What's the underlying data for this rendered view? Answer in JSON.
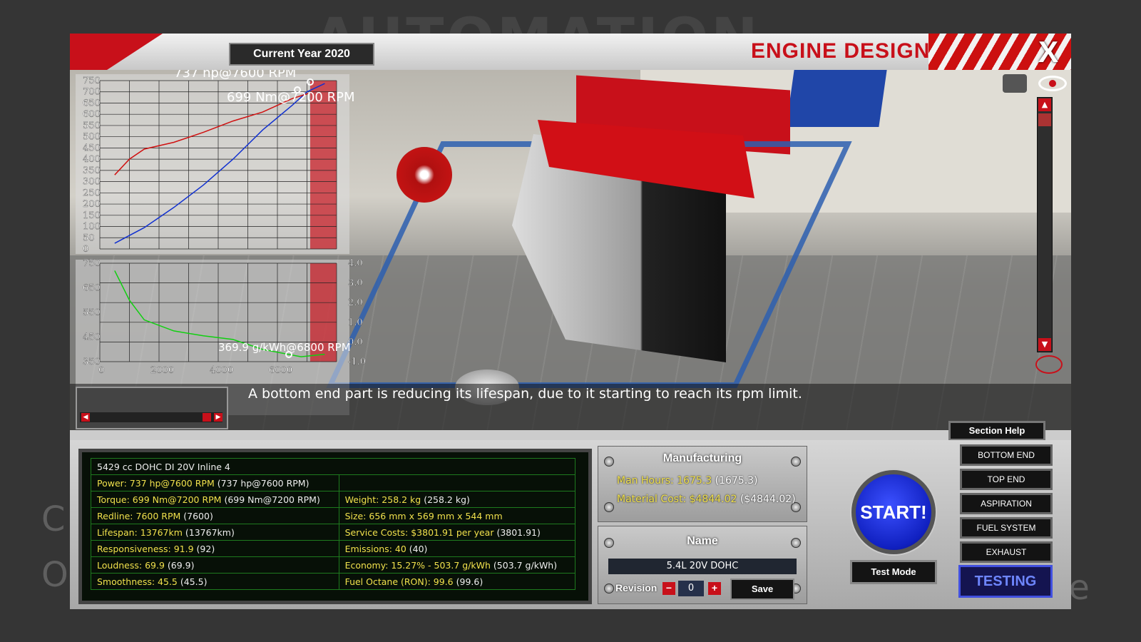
{
  "background": {
    "title": "AUTOMATION",
    "left_text_1": "C",
    "left_text_2": "O",
    "right_text": "he"
  },
  "header": {
    "current_year": "Current Year 2020",
    "title": "ENGINE DESIGN",
    "close": "X"
  },
  "graphs": {
    "power_label": "737 hp@7600 RPM",
    "torque_label": "699 Nm@7200 RPM",
    "bsfc_label": "369.9 g/kWh@6800 RPM",
    "top_y_ticks": [
      "750",
      "700",
      "650",
      "600",
      "550",
      "500",
      "450",
      "400",
      "350",
      "300",
      "250",
      "200",
      "150",
      "100",
      "50",
      "0"
    ],
    "bottom_y_ticks": [
      "750",
      "650",
      "550",
      "450",
      "350"
    ],
    "bottom_right_ticks": [
      "4.0",
      "3.0",
      "2.0",
      "1.0",
      "0.0",
      "-1.0"
    ],
    "x_ticks": [
      "0",
      "2000",
      "4000",
      "6000"
    ]
  },
  "chart_data": [
    {
      "type": "line",
      "x_unit": "RPM",
      "ylim": [
        0,
        750
      ],
      "series": [
        {
          "name": "Power",
          "color": "#1030d0",
          "x": [
            500,
            1500,
            2500,
            3500,
            4500,
            5500,
            6500,
            7000,
            7600
          ],
          "values": [
            25,
            95,
            185,
            285,
            400,
            530,
            640,
            700,
            737
          ]
        },
        {
          "name": "Torque",
          "color": "#d01010",
          "x": [
            500,
            1000,
            1500,
            2500,
            3500,
            4500,
            5500,
            6500,
            7200
          ],
          "values": [
            330,
            400,
            445,
            475,
            520,
            570,
            610,
            670,
            699
          ]
        }
      ]
    },
    {
      "type": "line",
      "x_unit": "RPM",
      "ylim": [
        350,
        750
      ],
      "series": [
        {
          "name": "BSFC",
          "color": "#10c010",
          "x": [
            500,
            1000,
            1500,
            2500,
            3500,
            4500,
            5500,
            6800,
            7600
          ],
          "values": [
            720,
            600,
            520,
            475,
            455,
            440,
            400,
            369.9,
            380
          ]
        }
      ]
    }
  ],
  "message": "A bottom end part is reducing its lifespan, due to it starting to reach its rpm limit.",
  "section_help": "Section Help",
  "stats": {
    "engine": "5429 cc DOHC DI 20V Inline 4",
    "rows": [
      {
        "left_label": "Power: 737 hp@7600 RPM",
        "left_value": " (737 hp@7600 RPM)",
        "right_label": "",
        "right_value": ""
      },
      {
        "left_label": "Torque: 699 Nm@7200 RPM",
        "left_value": " (699 Nm@7200 RPM)",
        "right_label": "Weight: 258.2 kg",
        "right_value": " (258.2 kg)"
      },
      {
        "left_label": "Redline: 7600 RPM",
        "left_value": " (7600)",
        "right_label": "Size: 656 mm x 569 mm x 544 mm",
        "right_value": ""
      },
      {
        "left_label": "Lifespan: 13767km",
        "left_value": " (13767km)",
        "right_label": "Service Costs: $3801.91 per year",
        "right_value": " (3801.91)"
      },
      {
        "left_label": "Responsiveness: 91.9",
        "left_value": " (92)",
        "right_label": "Emissions: 40",
        "right_value": " (40)"
      },
      {
        "left_label": "Loudness: 69.9",
        "left_value": " (69.9)",
        "right_label": "Economy: 15.27% - 503.7 g/kWh",
        "right_value": " (503.7 g/kWh)"
      },
      {
        "left_label": "Smoothness: 45.5",
        "left_value": " (45.5)",
        "right_label": "Fuel Octane (RON): 99.6",
        "right_value": " (99.6)"
      }
    ]
  },
  "manufacturing": {
    "title": "Manufacturing",
    "man_hours_label": "Man Hours: 1675.3",
    "man_hours_value": " (1675.3)",
    "material_cost_label": "Material Cost: $4844.02",
    "material_cost_value": " ($4844.02)"
  },
  "name_panel": {
    "title": "Name",
    "name": "5.4L 20V DOHC",
    "revision_label": "Revision",
    "minus": "−",
    "plus": "+",
    "revision": "0",
    "save": "Save"
  },
  "start": "START!",
  "test_mode": "Test Mode",
  "sections": [
    "BOTTOM END",
    "TOP END",
    "ASPIRATION",
    "FUEL SYSTEM",
    "EXHAUST"
  ],
  "testing": "TESTING",
  "scrollbar": {
    "up": "▲",
    "down": "▼",
    "left": "◀",
    "right": "▶"
  },
  "colors": {
    "accent_red": "#c8101a",
    "start_blue": "#1a30e0",
    "highlight_yellow": "#f0e04c"
  }
}
